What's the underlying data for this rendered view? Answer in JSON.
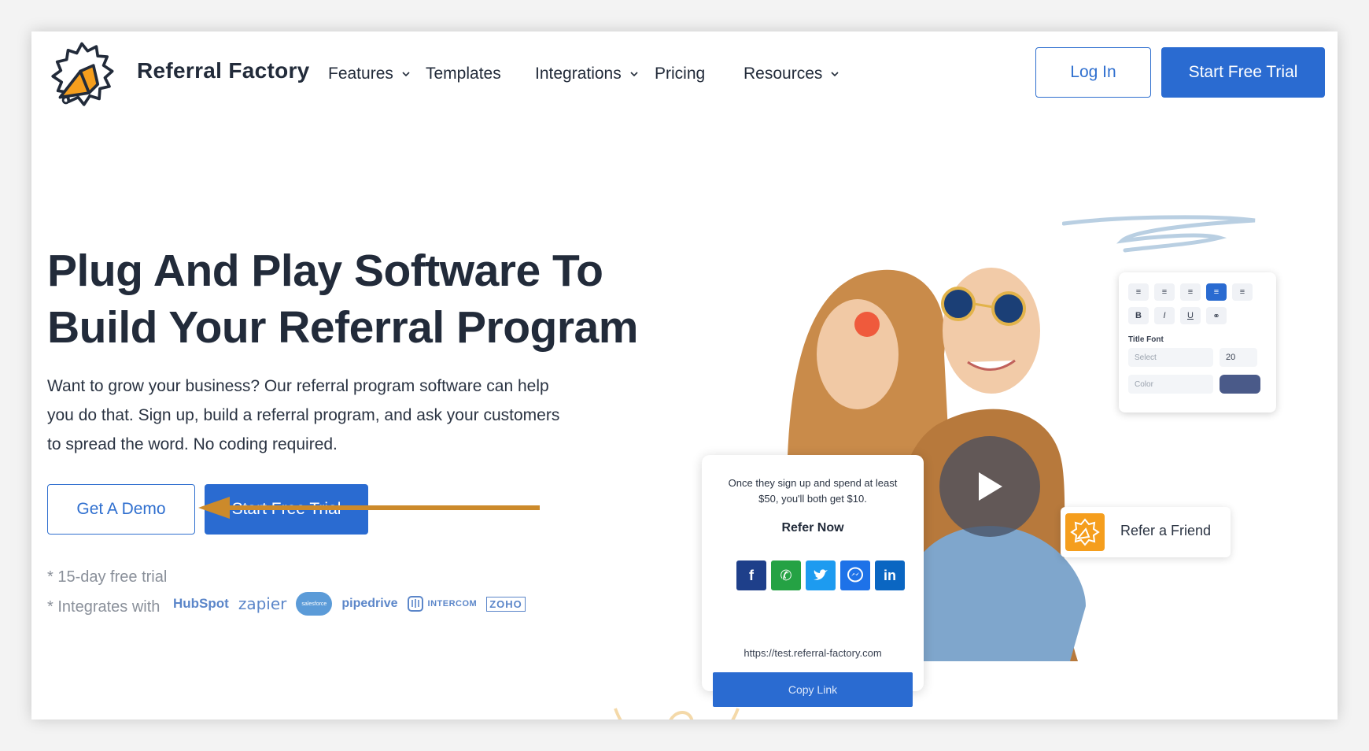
{
  "brand": {
    "name": "Referral Factory",
    "accent": "#2a6bd1",
    "logo_orange": "#f59e1d"
  },
  "nav": {
    "items": [
      {
        "label": "Features",
        "has_dropdown": true
      },
      {
        "label": "Templates",
        "has_dropdown": false
      },
      {
        "label": "Integrations",
        "has_dropdown": true
      },
      {
        "label": "Pricing",
        "has_dropdown": false
      },
      {
        "label": "Resources",
        "has_dropdown": true
      }
    ],
    "login_label": "Log In",
    "trial_label": "Start Free Trial"
  },
  "hero": {
    "title_line1": "Plug And Play Software To",
    "title_line2": "Build Your Referral Program",
    "description": "Want to grow your business? Our referral program software can help you do that. Sign up, build a referral program, and ask your customers to spread the word. No coding required.",
    "demo_label": "Get A Demo",
    "trial_label": "Start Free Trial",
    "note_trial": "* 15-day free trial",
    "note_integrations": "* Integrates with"
  },
  "integrations": [
    "HubSpot",
    "zapier",
    "salesforce",
    "pipedrive",
    "INTERCOM",
    "ZOHO"
  ],
  "editor": {
    "font_label": "Title Font",
    "select_placeholder": "Select",
    "size_value": "20",
    "color_placeholder": "Color",
    "toolbar_row1": [
      "align-justify-icon",
      "align-center-justify-icon",
      "align-left-icon",
      "align-center-icon",
      "align-right-icon"
    ],
    "toolbar_row2": [
      "B",
      "I",
      "U",
      "link-icon"
    ]
  },
  "refer_card": {
    "message": "Once they sign up and spend at least $50, you'll both get $10.",
    "title": "Refer Now",
    "social": [
      {
        "name": "facebook-icon",
        "glyph": "f",
        "color": "#1e3f8a"
      },
      {
        "name": "whatsapp-icon",
        "glyph": "✆",
        "color": "#25a244"
      },
      {
        "name": "twitter-icon",
        "glyph": "🐦",
        "color": "#1d9bf0"
      },
      {
        "name": "messenger-icon",
        "glyph": "⚡",
        "color": "#1e72e8"
      },
      {
        "name": "linkedin-icon",
        "glyph": "in",
        "color": "#0a66c2"
      }
    ],
    "url": "https://test.referral-factory.com",
    "copy_label": "Copy Link"
  },
  "refer_friend_label": "Refer a Friend"
}
